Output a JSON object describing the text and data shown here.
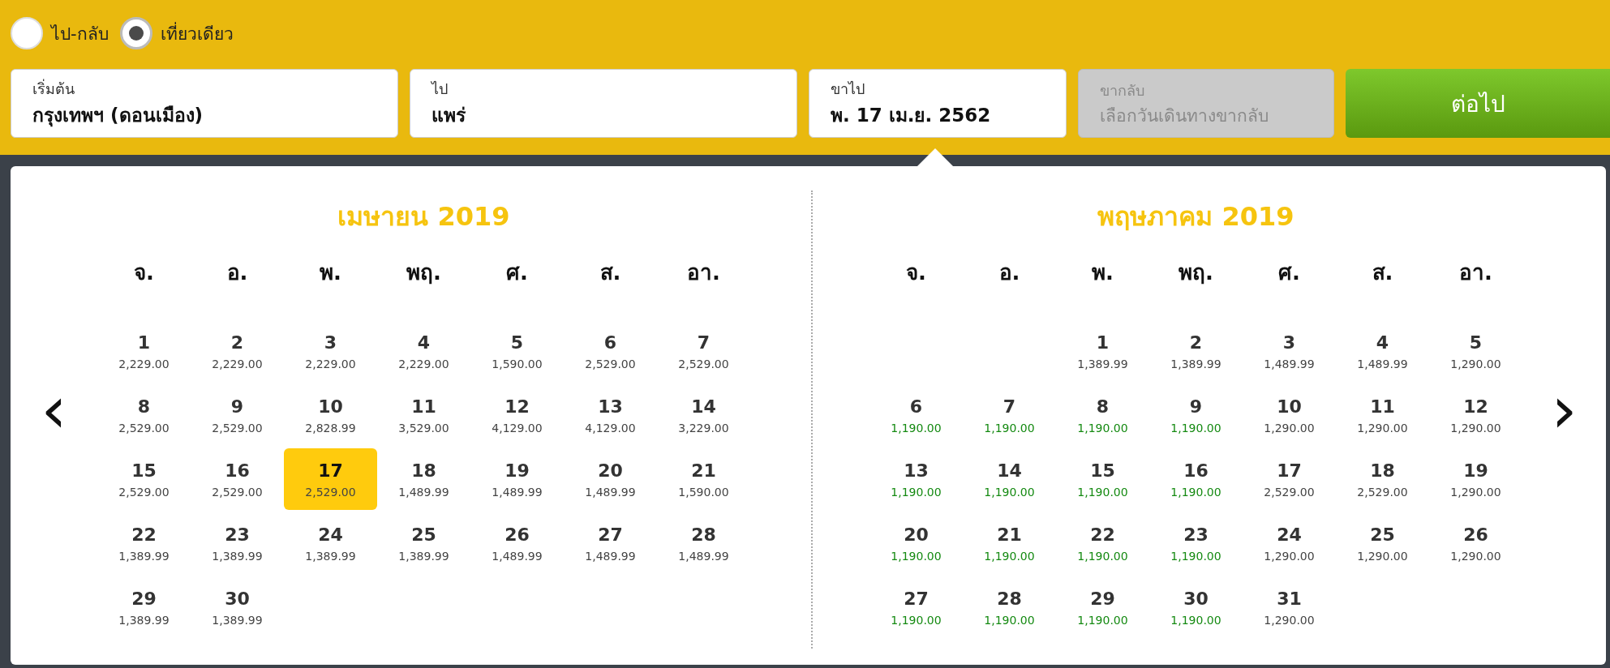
{
  "trip_types": [
    {
      "label": "ไป-กลับ",
      "selected": false
    },
    {
      "label": "เที่ยวเดียว",
      "selected": true
    }
  ],
  "fields": [
    {
      "label": "เริ่มต้น",
      "value": "กรุงเทพฯ (ดอนเมือง)",
      "disabled": false
    },
    {
      "label": "ไป",
      "value": "แพร่",
      "disabled": false
    },
    {
      "label": "ขาไป",
      "value": "พ. 17 เม.ย. 2562",
      "disabled": false
    },
    {
      "label": "ขากลับ",
      "placeholder": "เลือกวันเดินทางขากลับ",
      "disabled": true
    }
  ],
  "next_button": "ต่อไป",
  "prev_arrow": "‹",
  "next_arrow": "›",
  "months": [
    {
      "title": "เมษายน 2019",
      "weekdays": [
        "จ.",
        "อ.",
        "พ.",
        "พฤ.",
        "ศ.",
        "ส.",
        "อา."
      ],
      "days": [
        {
          "kind": "day",
          "day": "1",
          "price": "2,229.00",
          "cheapest": false,
          "selected": false
        },
        {
          "kind": "day",
          "day": "2",
          "price": "2,229.00",
          "cheapest": false,
          "selected": false
        },
        {
          "kind": "day",
          "day": "3",
          "price": "2,229.00",
          "cheapest": false,
          "selected": false
        },
        {
          "kind": "day",
          "day": "4",
          "price": "2,229.00",
          "cheapest": false,
          "selected": false
        },
        {
          "kind": "day",
          "day": "5",
          "price": "1,590.00",
          "cheapest": false,
          "selected": false
        },
        {
          "kind": "day",
          "day": "6",
          "price": "2,529.00",
          "cheapest": false,
          "selected": false
        },
        {
          "kind": "day",
          "day": "7",
          "price": "2,529.00",
          "cheapest": false,
          "selected": false
        },
        {
          "kind": "day",
          "day": "8",
          "price": "2,529.00",
          "cheapest": false,
          "selected": false
        },
        {
          "kind": "day",
          "day": "9",
          "price": "2,529.00",
          "cheapest": false,
          "selected": false
        },
        {
          "kind": "day",
          "day": "10",
          "price": "2,828.99",
          "cheapest": false,
          "selected": false
        },
        {
          "kind": "day",
          "day": "11",
          "price": "3,529.00",
          "cheapest": false,
          "selected": false
        },
        {
          "kind": "day",
          "day": "12",
          "price": "4,129.00",
          "cheapest": false,
          "selected": false
        },
        {
          "kind": "day",
          "day": "13",
          "price": "4,129.00",
          "cheapest": false,
          "selected": false
        },
        {
          "kind": "day",
          "day": "14",
          "price": "3,229.00",
          "cheapest": false,
          "selected": false
        },
        {
          "kind": "day",
          "day": "15",
          "price": "2,529.00",
          "cheapest": false,
          "selected": false
        },
        {
          "kind": "day",
          "day": "16",
          "price": "2,529.00",
          "cheapest": false,
          "selected": false
        },
        {
          "kind": "day",
          "day": "17",
          "price": "2,529.00",
          "cheapest": false,
          "selected": true
        },
        {
          "kind": "day",
          "day": "18",
          "price": "1,489.99",
          "cheapest": false,
          "selected": false
        },
        {
          "kind": "day",
          "day": "19",
          "price": "1,489.99",
          "cheapest": false,
          "selected": false
        },
        {
          "kind": "day",
          "day": "20",
          "price": "1,489.99",
          "cheapest": false,
          "selected": false
        },
        {
          "kind": "day",
          "day": "21",
          "price": "1,590.00",
          "cheapest": false,
          "selected": false
        },
        {
          "kind": "day",
          "day": "22",
          "price": "1,389.99",
          "cheapest": false,
          "selected": false
        },
        {
          "kind": "day",
          "day": "23",
          "price": "1,389.99",
          "cheapest": false,
          "selected": false
        },
        {
          "kind": "day",
          "day": "24",
          "price": "1,389.99",
          "cheapest": false,
          "selected": false
        },
        {
          "kind": "day",
          "day": "25",
          "price": "1,389.99",
          "cheapest": false,
          "selected": false
        },
        {
          "kind": "day",
          "day": "26",
          "price": "1,489.99",
          "cheapest": false,
          "selected": false
        },
        {
          "kind": "day",
          "day": "27",
          "price": "1,489.99",
          "cheapest": false,
          "selected": false
        },
        {
          "kind": "day",
          "day": "28",
          "price": "1,489.99",
          "cheapest": false,
          "selected": false
        },
        {
          "kind": "day",
          "day": "29",
          "price": "1,389.99",
          "cheapest": false,
          "selected": false
        },
        {
          "kind": "day",
          "day": "30",
          "price": "1,389.99",
          "cheapest": false,
          "selected": false
        }
      ]
    },
    {
      "title": "พฤษภาคม 2019",
      "weekdays": [
        "จ.",
        "อ.",
        "พ.",
        "พฤ.",
        "ศ.",
        "ส.",
        "อา."
      ],
      "days": [
        {
          "kind": "blank"
        },
        {
          "kind": "blank"
        },
        {
          "kind": "day",
          "day": "1",
          "price": "1,389.99",
          "cheapest": false,
          "selected": false
        },
        {
          "kind": "day",
          "day": "2",
          "price": "1,389.99",
          "cheapest": false,
          "selected": false
        },
        {
          "kind": "day",
          "day": "3",
          "price": "1,489.99",
          "cheapest": false,
          "selected": false
        },
        {
          "kind": "day",
          "day": "4",
          "price": "1,489.99",
          "cheapest": false,
          "selected": false
        },
        {
          "kind": "day",
          "day": "5",
          "price": "1,290.00",
          "cheapest": false,
          "selected": false
        },
        {
          "kind": "day",
          "day": "6",
          "price": "1,190.00",
          "cheapest": true,
          "selected": false
        },
        {
          "kind": "day",
          "day": "7",
          "price": "1,190.00",
          "cheapest": true,
          "selected": false
        },
        {
          "kind": "day",
          "day": "8",
          "price": "1,190.00",
          "cheapest": true,
          "selected": false
        },
        {
          "kind": "day",
          "day": "9",
          "price": "1,190.00",
          "cheapest": true,
          "selected": false
        },
        {
          "kind": "day",
          "day": "10",
          "price": "1,290.00",
          "cheapest": false,
          "selected": false
        },
        {
          "kind": "day",
          "day": "11",
          "price": "1,290.00",
          "cheapest": false,
          "selected": false
        },
        {
          "kind": "day",
          "day": "12",
          "price": "1,290.00",
          "cheapest": false,
          "selected": false
        },
        {
          "kind": "day",
          "day": "13",
          "price": "1,190.00",
          "cheapest": true,
          "selected": false
        },
        {
          "kind": "day",
          "day": "14",
          "price": "1,190.00",
          "cheapest": true,
          "selected": false
        },
        {
          "kind": "day",
          "day": "15",
          "price": "1,190.00",
          "cheapest": true,
          "selected": false
        },
        {
          "kind": "day",
          "day": "16",
          "price": "1,190.00",
          "cheapest": true,
          "selected": false
        },
        {
          "kind": "day",
          "day": "17",
          "price": "2,529.00",
          "cheapest": false,
          "selected": false
        },
        {
          "kind": "day",
          "day": "18",
          "price": "2,529.00",
          "cheapest": false,
          "selected": false
        },
        {
          "kind": "day",
          "day": "19",
          "price": "1,290.00",
          "cheapest": false,
          "selected": false
        },
        {
          "kind": "day",
          "day": "20",
          "price": "1,190.00",
          "cheapest": true,
          "selected": false
        },
        {
          "kind": "day",
          "day": "21",
          "price": "1,190.00",
          "cheapest": true,
          "selected": false
        },
        {
          "kind": "day",
          "day": "22",
          "price": "1,190.00",
          "cheapest": true,
          "selected": false
        },
        {
          "kind": "day",
          "day": "23",
          "price": "1,190.00",
          "cheapest": true,
          "selected": false
        },
        {
          "kind": "day",
          "day": "24",
          "price": "1,290.00",
          "cheapest": false,
          "selected": false
        },
        {
          "kind": "day",
          "day": "25",
          "price": "1,290.00",
          "cheapest": false,
          "selected": false
        },
        {
          "kind": "day",
          "day": "26",
          "price": "1,290.00",
          "cheapest": false,
          "selected": false
        },
        {
          "kind": "day",
          "day": "27",
          "price": "1,190.00",
          "cheapest": true,
          "selected": false
        },
        {
          "kind": "day",
          "day": "28",
          "price": "1,190.00",
          "cheapest": true,
          "selected": false
        },
        {
          "kind": "day",
          "day": "29",
          "price": "1,190.00",
          "cheapest": true,
          "selected": false
        },
        {
          "kind": "day",
          "day": "30",
          "price": "1,190.00",
          "cheapest": true,
          "selected": false
        },
        {
          "kind": "day",
          "day": "31",
          "price": "1,290.00",
          "cheapest": false,
          "selected": false
        }
      ]
    }
  ]
}
